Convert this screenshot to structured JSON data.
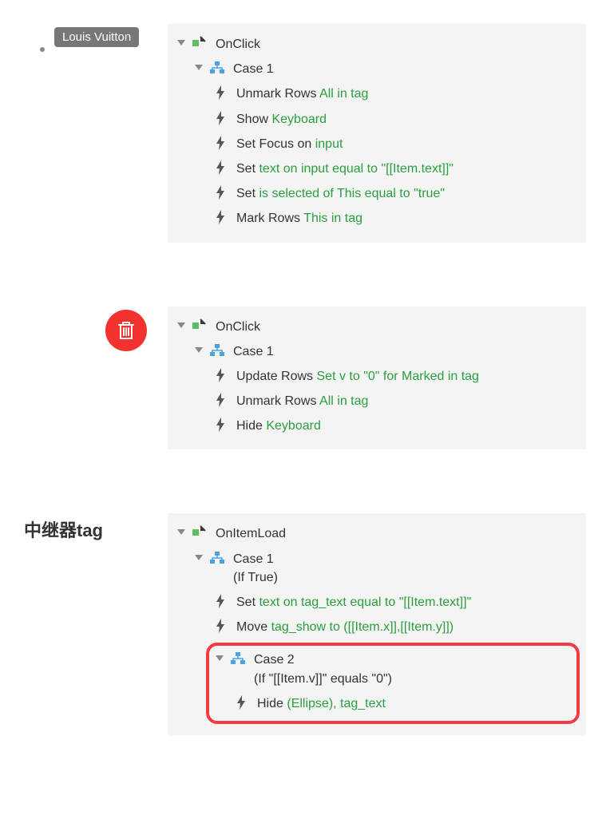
{
  "sections": {
    "s0": {
      "left_badge": "Louis Vuitton",
      "event": "OnClick",
      "case": "Case 1",
      "actions": {
        "a0_prefix": "Unmark Rows ",
        "a0_green": "All in tag",
        "a1_prefix": "Show ",
        "a1_green": "Keyboard",
        "a2_prefix": "Set Focus on ",
        "a2_green": "input",
        "a3_prefix": "Set ",
        "a3_green": "text on input equal to \"[[Item.text]]\"",
        "a4_prefix": "Set ",
        "a4_green": "is selected of This equal to \"true\"",
        "a5_prefix": "Mark Rows ",
        "a5_green": "This in tag"
      }
    },
    "s1": {
      "event": "OnClick",
      "case": "Case 1",
      "actions": {
        "a0_prefix": "Update Rows ",
        "a0_green": "Set v to \"0\" for Marked in tag",
        "a1_prefix": "Unmark Rows ",
        "a1_green": "All in tag",
        "a2_prefix": "Hide ",
        "a2_green": "Keyboard"
      }
    },
    "s2": {
      "title": "中继器tag",
      "event": "OnItemLoad",
      "case1": "Case 1",
      "case1_cond": "(If True)",
      "c1_actions": {
        "a0_prefix": "Set ",
        "a0_green": "text on tag_text equal to \"[[Item.text]]\"",
        "a1_prefix": "Move ",
        "a1_green": "tag_show to ([[Item.x]],[[Item.y]])"
      },
      "case2": "Case 2",
      "case2_cond": "(If \"[[Item.v]]\" equals \"0\")",
      "c2_actions": {
        "a0_prefix": "Hide ",
        "a0_green": "(Ellipse), tag_text"
      }
    }
  }
}
